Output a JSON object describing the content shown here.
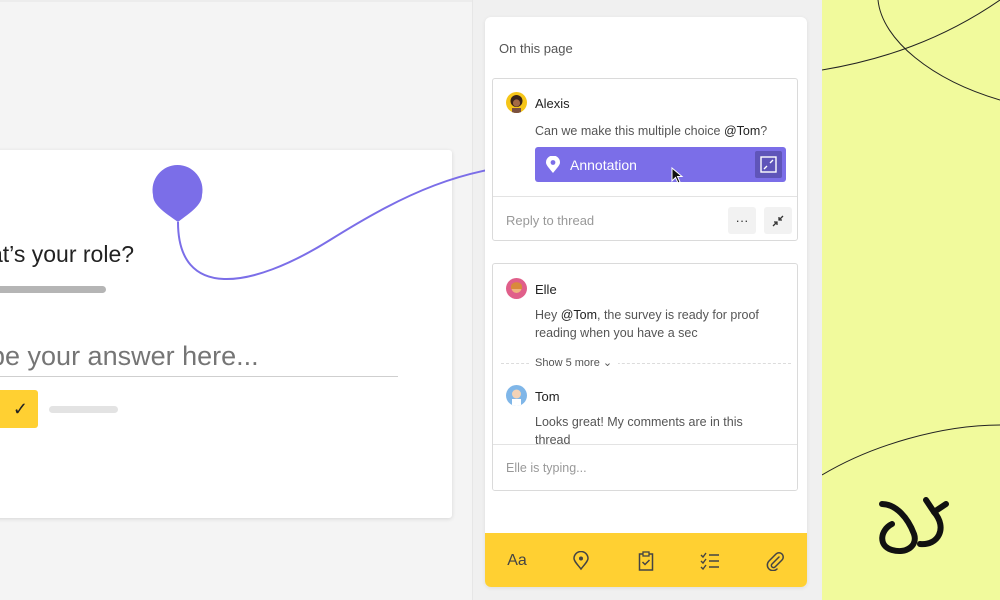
{
  "form": {
    "question": "at’s your role?",
    "answer_placeholder": "pe your answer here..."
  },
  "panel": {
    "title": "On this page",
    "thread1": {
      "author": "Alexis",
      "message_pre": "Can we make this multiple choice ",
      "mention": "@Tom",
      "message_post": "?",
      "annotation_label": "Annotation",
      "reply_placeholder": "Reply to thread",
      "more_label": "···"
    },
    "thread2": {
      "author1": "Elle",
      "message1_pre": "Hey ",
      "mention1": "@Tom",
      "message1_post": ", the survey is ready for proof reading when you have a sec",
      "show_more": "Show 5 more",
      "author2": "Tom",
      "message2": "Looks great! My comments are in this thread",
      "typing": "Elle is typing..."
    },
    "toolbar": {
      "text_label": "Aa",
      "icons": [
        "text-format-icon",
        "location-pin-icon",
        "clipboard-check-icon",
        "checklist-icon",
        "paperclip-icon"
      ]
    }
  },
  "colors": {
    "accent": "#7b6ee8",
    "toolbar": "#ffd032",
    "background_right": "#f1fa9c"
  }
}
